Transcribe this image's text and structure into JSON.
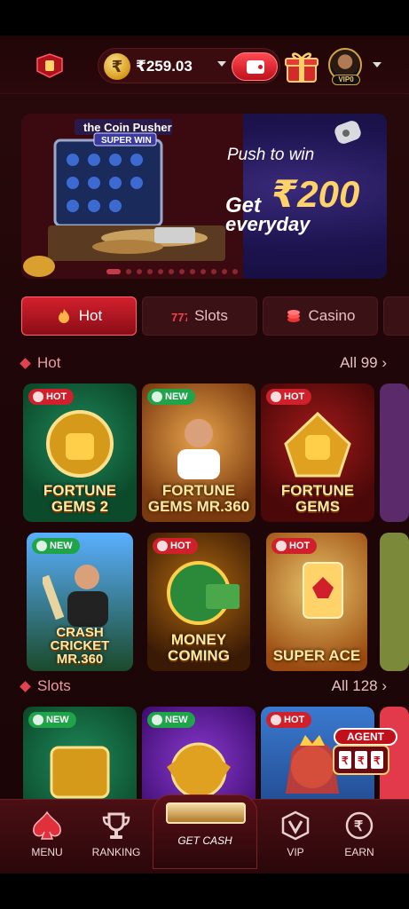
{
  "header": {
    "balance": "₹259.03",
    "coin_symbol": "₹",
    "vip_tag": "VIP0"
  },
  "banner": {
    "machine_title": "the Coin Pusher",
    "machine_sub": "SUPER WIN",
    "headline": "Push to win",
    "get": "Get",
    "amount": "₹200",
    "everyday": "everyday",
    "slide_count": 13,
    "active_slide": 1
  },
  "tabs": [
    {
      "label": "Hot",
      "active": true
    },
    {
      "label": "Slots",
      "active": false
    },
    {
      "label": "Casino",
      "active": false
    }
  ],
  "sections": {
    "hot": {
      "title": "Hot",
      "all_label": "All 99 ›",
      "games": [
        {
          "badge": "HOT",
          "name": "FORTUNE GEMS 2"
        },
        {
          "badge": "NEW",
          "name": "FORTUNE GEMS MR.360"
        },
        {
          "badge": "HOT",
          "name": "FORTUNE GEMS"
        },
        {
          "badge": "NEW",
          "name": "CRASH CRICKET MR.360"
        },
        {
          "badge": "HOT",
          "name": "MONEY COMING"
        },
        {
          "badge": "HOT",
          "name": "SUPER ACE"
        }
      ]
    },
    "slots": {
      "title": "Slots",
      "all_label": "All 128 ›",
      "games": [
        {
          "badge": "NEW"
        },
        {
          "badge": "NEW"
        },
        {
          "badge": "HOT"
        }
      ]
    }
  },
  "agent_label": "AGENT",
  "nav": {
    "menu": "MENU",
    "ranking": "RANKING",
    "get_cash": "GET CASH",
    "vip": "VIP",
    "earn": "EARN"
  },
  "colors": {
    "accent": "#d3202d",
    "background": "#1f0608",
    "gold": "#ffd36a",
    "badge_hot": "#d0202c",
    "badge_new": "#1fa44a"
  }
}
